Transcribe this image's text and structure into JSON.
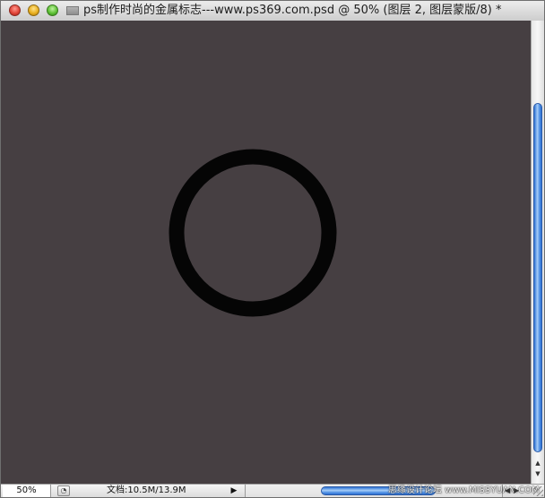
{
  "window": {
    "title": "ps制作时尚的金属标志---www.ps369.com.psd @ 50% (图层 2, 图层蒙版/8) *"
  },
  "status": {
    "zoom": "50%",
    "doc_info": "文档:10.5M/13.9M"
  },
  "watermark": {
    "text": "思缘设计论坛 www.MISSYUAN.COM"
  },
  "icons": {
    "close": "close-icon",
    "minimize": "minimize-icon",
    "zoom": "zoom-icon",
    "doc_proxy": "document-icon",
    "status_menu": "triangle-right-icon",
    "zoom_button": "zoom-button-icon"
  },
  "colors": {
    "canvas": "#463f42",
    "ring": "#050505",
    "scroll_accent": "#5a98e8"
  }
}
